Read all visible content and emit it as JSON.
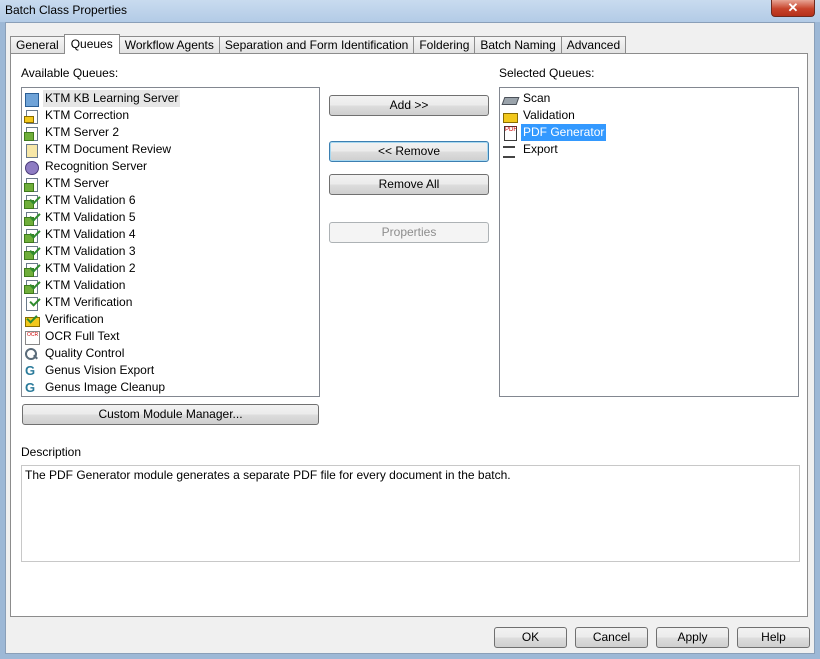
{
  "window": {
    "title": "Batch Class Properties",
    "close_glyph": "✕"
  },
  "tabs": [
    {
      "label": "General"
    },
    {
      "label": "Queues"
    },
    {
      "label": "Workflow Agents"
    },
    {
      "label": "Separation and Form Identification"
    },
    {
      "label": "Foldering"
    },
    {
      "label": "Batch Naming"
    },
    {
      "label": "Advanced"
    }
  ],
  "active_tab": "Queues",
  "available": {
    "label": "Available Queues:",
    "items": [
      {
        "text": "KTM KB Learning Server",
        "icon": "kb-learning-icon",
        "state": "highlighted"
      },
      {
        "text": "KTM Correction",
        "icon": "correction-icon"
      },
      {
        "text": "KTM Server 2",
        "icon": "server-icon"
      },
      {
        "text": "KTM Document Review",
        "icon": "document-review-icon"
      },
      {
        "text": "Recognition Server",
        "icon": "recognition-icon"
      },
      {
        "text": "KTM Server",
        "icon": "server-icon"
      },
      {
        "text": "KTM Validation 6",
        "icon": "validation-check-icon"
      },
      {
        "text": "KTM Validation 5",
        "icon": "validation-check-icon"
      },
      {
        "text": "KTM Validation 4",
        "icon": "validation-check-icon"
      },
      {
        "text": "KTM Validation 3",
        "icon": "validation-check-icon"
      },
      {
        "text": "KTM Validation 2",
        "icon": "validation-check-icon"
      },
      {
        "text": "KTM Validation",
        "icon": "validation-check-icon"
      },
      {
        "text": "KTM Verification",
        "icon": "verification-icon"
      },
      {
        "text": "Verification",
        "icon": "verification-yellow-icon"
      },
      {
        "text": "OCR Full Text",
        "icon": "ocr-icon"
      },
      {
        "text": "Quality Control",
        "icon": "quality-control-icon"
      },
      {
        "text": "Genus Vision Export",
        "icon": "genus-icon"
      },
      {
        "text": "Genus Image Cleanup",
        "icon": "genus-icon"
      }
    ]
  },
  "selected": {
    "label": "Selected Queues:",
    "items": [
      {
        "text": "Scan",
        "icon": "scanner-icon"
      },
      {
        "text": "Validation",
        "icon": "validation-yellow-icon"
      },
      {
        "text": "PDF Generator",
        "icon": "pdf-icon",
        "state": "selected"
      },
      {
        "text": "Export",
        "icon": "export-icon"
      }
    ]
  },
  "buttons": {
    "add": "Add >>",
    "remove": "<< Remove",
    "remove_all": "Remove All",
    "properties": "Properties",
    "custom_module_manager": "Custom Module Manager..."
  },
  "description": {
    "label": "Description",
    "text": "The PDF Generator module generates a separate PDF file for every document in the batch."
  },
  "footer": {
    "ok": "OK",
    "cancel": "Cancel",
    "apply": "Apply",
    "help": "Help"
  },
  "colors": {
    "selection": "#3399ff",
    "title_bar": "#c9dbef",
    "close_button": "#c7432b"
  }
}
